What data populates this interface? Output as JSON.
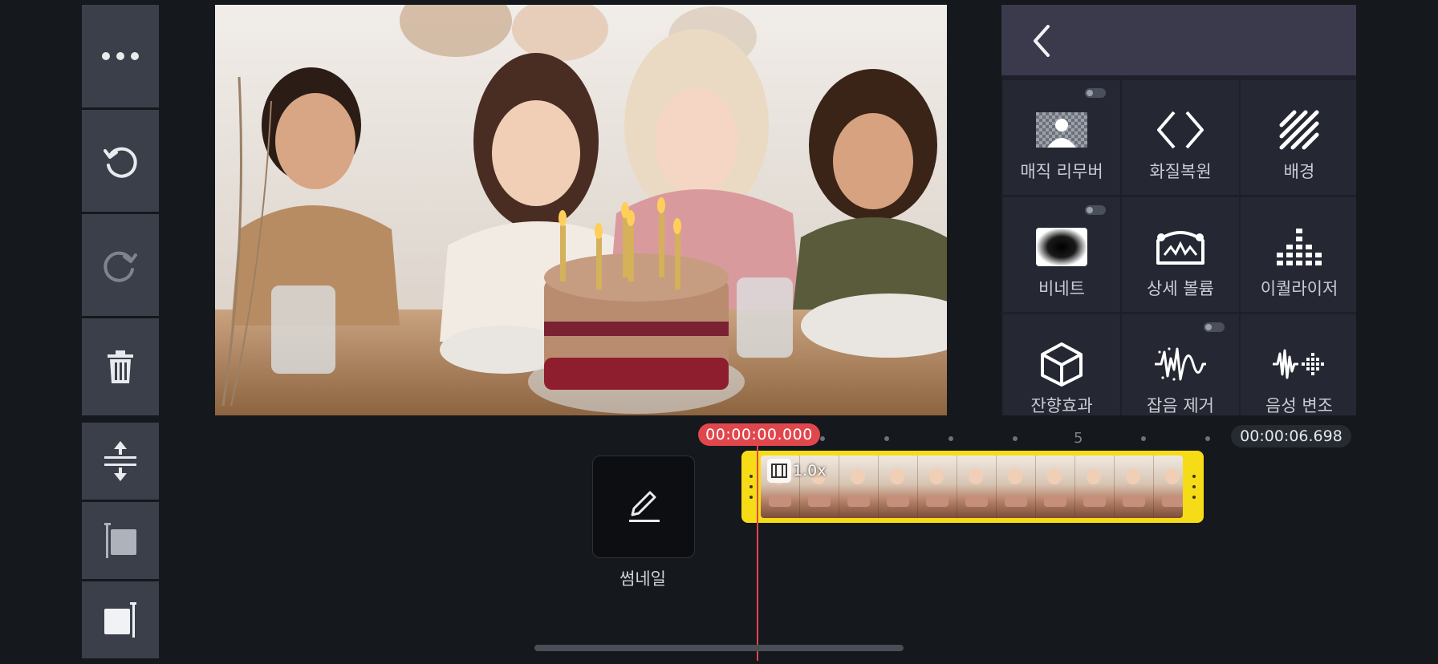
{
  "toolbar": {
    "more": "more-icon",
    "undo": "undo-icon",
    "redo": "redo-icon",
    "delete": "trash-icon",
    "expand_track": "expand-icon",
    "trim_start": "trim-start-icon",
    "trim_end": "trim-end-icon"
  },
  "panel": {
    "back": "chevron-left-icon",
    "items": [
      {
        "label": "매직 리무버",
        "icon": "person-cutout-icon"
      },
      {
        "label": "화질복원",
        "icon": "code-brackets-icon"
      },
      {
        "label": "배경",
        "icon": "diagonal-lines-icon"
      },
      {
        "label": "비네트",
        "icon": "vignette-icon"
      },
      {
        "label": "상세 볼륨",
        "icon": "volume-envelope-icon"
      },
      {
        "label": "이퀄라이저",
        "icon": "equalizer-icon"
      },
      {
        "label": "잔향효과",
        "icon": "cube-icon"
      },
      {
        "label": "잡음 제거",
        "icon": "noise-wave-icon"
      },
      {
        "label": "음성 변조",
        "icon": "voice-wave-icon"
      }
    ]
  },
  "timeline": {
    "current_time": "00:00:00.000",
    "total_time": "00:00:06.698",
    "ruler_label": "5",
    "thumbnail_label": "썸네일",
    "clip_speed": "1.0x"
  },
  "colors": {
    "accent_red": "#e0474d",
    "clip_yellow": "#f6dc16",
    "toolbar_bg": "#3a3f4a",
    "panel_bg": "#252833"
  }
}
